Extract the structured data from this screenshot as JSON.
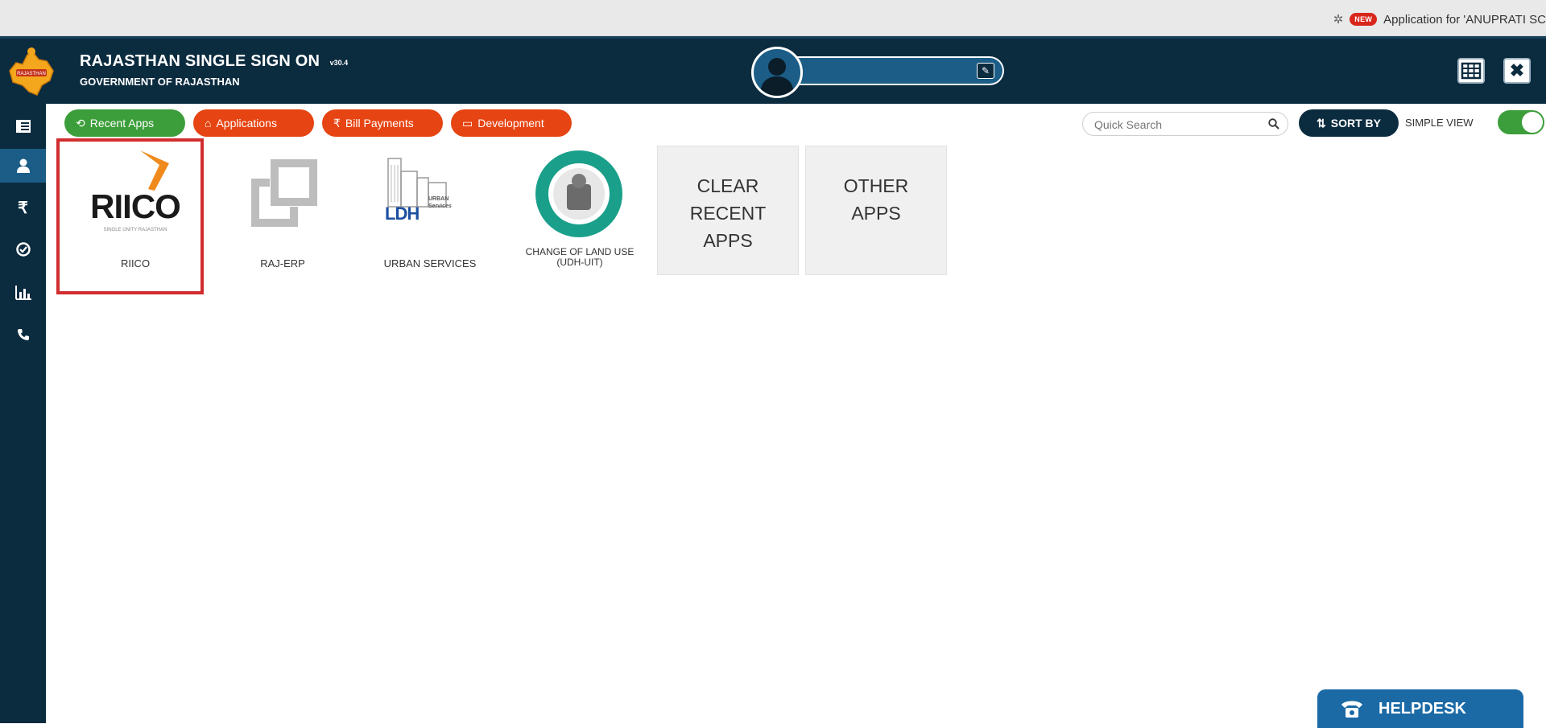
{
  "notice": {
    "new_badge": "NEW",
    "text": "Application for 'ANUPRATI SC"
  },
  "header": {
    "title": "RAJASTHAN SINGLE SIGN ON",
    "version": "v30.4",
    "subtitle": "GOVERNMENT OF RAJASTHAN"
  },
  "sidebar": {
    "items": [
      {
        "icon": "list-icon"
      },
      {
        "icon": "user-icon"
      },
      {
        "icon": "rupee-icon",
        "glyph": "₹"
      },
      {
        "icon": "check-circle-icon"
      },
      {
        "icon": "bar-chart-icon"
      },
      {
        "icon": "phone-icon"
      }
    ]
  },
  "tabs": [
    {
      "label": "Recent Apps",
      "color": "#3c9e3a"
    },
    {
      "label": "Applications",
      "color": "#e64412"
    },
    {
      "label": "Bill Payments",
      "color": "#e64412"
    },
    {
      "label": "Development",
      "color": "#e64412"
    }
  ],
  "search": {
    "placeholder": "Quick Search"
  },
  "sort": {
    "label": "SORT BY"
  },
  "view_toggle": {
    "label": "SIMPLE VIEW"
  },
  "apps": [
    {
      "name": "RIICO",
      "logo_text": "RIICO",
      "logo_sub": "SINGLE UNITY RAJASTHAN"
    },
    {
      "name": "RAJ-ERP"
    },
    {
      "name": "URBAN SERVICES",
      "logo_text": "LDH",
      "logo_tag": "URBAN Services"
    },
    {
      "name": "CHANGE OF LAND USE",
      "name_line2": "(UDH-UIT)"
    }
  ],
  "actions": {
    "clear_recent": [
      "CLEAR",
      "RECENT",
      "APPS"
    ],
    "other_apps": [
      "OTHER",
      "APPS"
    ]
  },
  "helpdesk": {
    "label": "HELPDESK"
  },
  "colors": {
    "header_bg": "#0b2b3f",
    "accent_green": "#3c9e3a",
    "accent_orange": "#e64412",
    "highlight_red": "#d12d2f"
  }
}
